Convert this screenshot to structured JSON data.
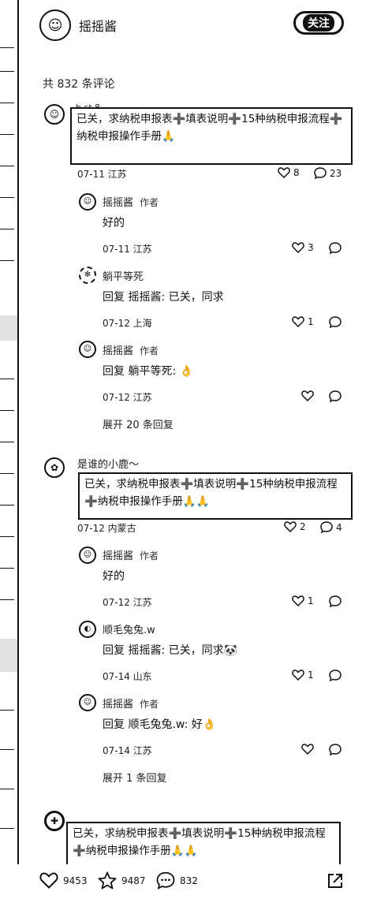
{
  "header": {
    "username": "摇摇酱",
    "follow_label": "关注"
  },
  "comment_count": "共 832 条评论",
  "threads": [
    {
      "user": "h.st.8",
      "text": "已关，求纳税申报表➕填表说明➕15种纳税申报流程➕纳税申报操作手册🙏",
      "date_loc": "07-11 江苏",
      "likes": "8",
      "replies": "23",
      "children": [
        {
          "user": "摇摇酱",
          "tag": "作者",
          "text": "好的",
          "date_loc": "07-11 江苏",
          "likes": "3"
        },
        {
          "user": "躺平等死",
          "tag": "",
          "text": "回复 摇摇酱: 已关，同求",
          "date_loc": "07-12 上海",
          "likes": "1"
        },
        {
          "user": "摇摇酱",
          "tag": "作者",
          "text": "回复 躺平等死: 👌",
          "date_loc": "07-12 江苏",
          "likes": ""
        }
      ],
      "expand": "展开 20 条回复"
    },
    {
      "user": "是谁的小鹿～",
      "text": "已关，求纳税申报表➕填表说明➕15种纳税申报流程➕纳税申报操作手册🙏🙏",
      "date_loc": "07-12 内蒙古",
      "likes": "2",
      "replies": "4",
      "children": [
        {
          "user": "摇摇酱",
          "tag": "作者",
          "text": "好的",
          "date_loc": "07-12 江苏",
          "likes": "1"
        },
        {
          "user": "顺毛兔兔.w",
          "tag": "",
          "text": "回复 摇摇酱: 已关，同求🐼",
          "date_loc": "07-14 山东",
          "likes": "1"
        },
        {
          "user": "摇摇酱",
          "tag": "作者",
          "text": "回复 顺毛兔兔.w: 好👌",
          "date_loc": "07-14 江苏",
          "likes": ""
        }
      ],
      "expand": "展开 1 条回复"
    },
    {
      "user": "",
      "text": "已关，求纳税申报表➕填表说明➕15种纳税申报流程➕纳税申报操作手册🙏🙏"
    }
  ],
  "bottom_bar": {
    "likes": "9453",
    "stars": "9487",
    "comments": "832"
  },
  "icons": {
    "heart": "heart-icon",
    "reply": "comment-bubble-icon",
    "star": "star-icon",
    "share": "share-icon"
  }
}
